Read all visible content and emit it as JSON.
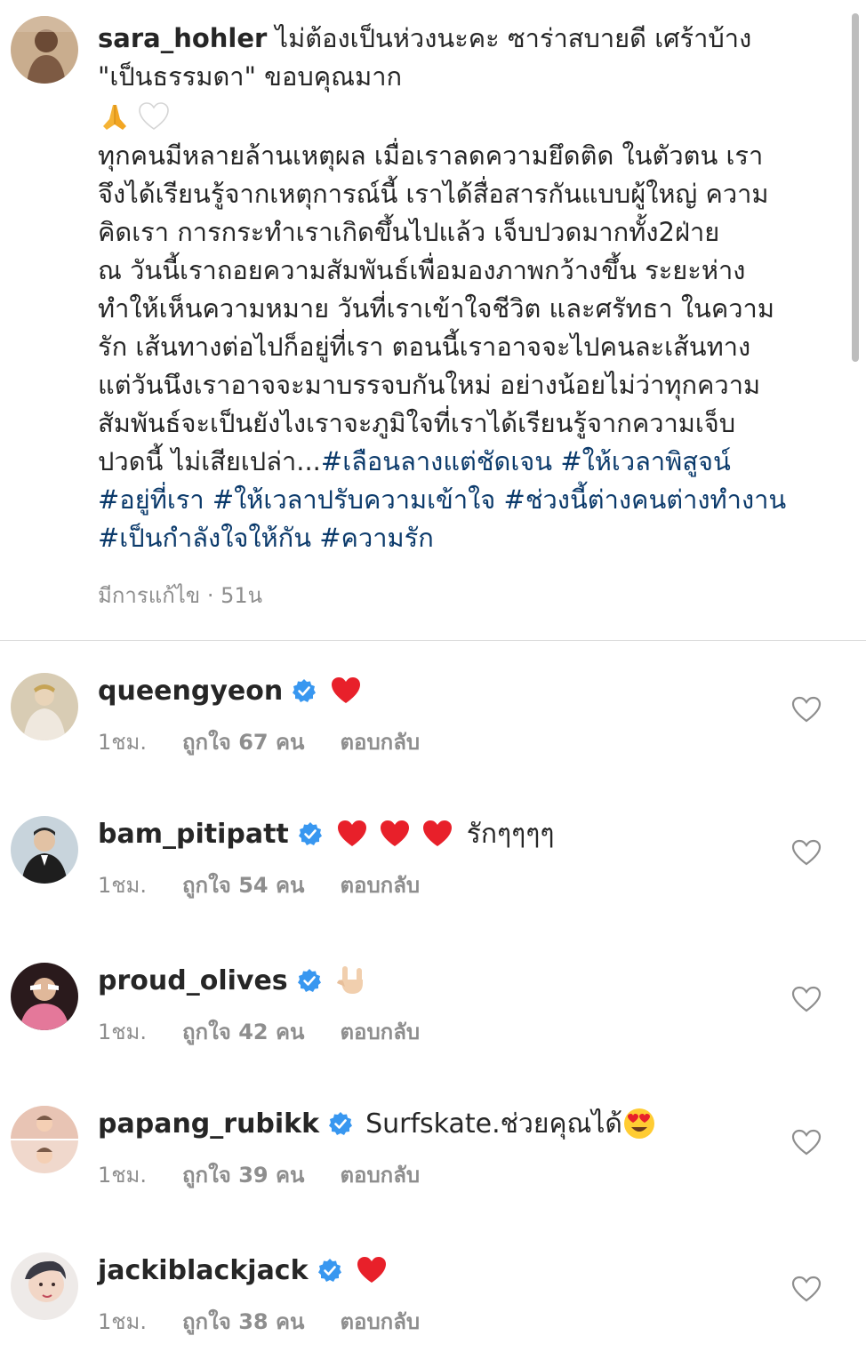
{
  "post": {
    "username": "sara_hohler",
    "caption_lines": [
      "ไม่ต้องเป็นห่วงนะคะ ซาร่าสบายดี เศร้าบ้าง",
      "\"เป็นธรรมดา\" ขอบคุณมาก"
    ],
    "caption_emojis": [
      "folded-hands-emoji",
      "white-heart-emoji"
    ],
    "body_lines": [
      "ทุกคนมีหลายล้านเหตุผล เมื่อเราลดความยึดติด ในตัวตน เรา",
      "จึงได้เรียนรู้จากเหตุการณ์นี้ เราได้สื่อสารกันแบบผู้ใหญ่ ความ",
      "คิดเรา การกระทำเราเกิดขึ้นไปแล้ว เจ็บปวดมากทั้ง2ฝ่าย",
      "ณ วันนี้เราถอยความสัมพันธ์เพื่อมองภาพกว้างขึ้น ระยะห่าง",
      "ทำให้เห็นความหมาย วันที่เราเข้าใจชีวิต และศรัทธา ในความ",
      "รัก เส้นทางต่อไปก็อยู่ที่เรา ตอนนี้เราอาจจะไปคนละเส้นทาง",
      "แต่วันนึงเราอาจจะมาบรรจบกันใหม่ อย่างน้อยไม่ว่าทุกความ",
      "สัมพันธ์จะเป็นยังไงเราจะภูมิใจที่เราได้เรียนรู้จากความเจ็บ"
    ],
    "body_last_text": "ปวดนี้ ไม่เสียเปล่า...",
    "hashtags_line1": [
      "#เลือนลางแต่ชัดเจน",
      "#ให้เวลาพิสูจน์"
    ],
    "hashtags_line2": [
      "#อยู่ที่เรา",
      "#ให้เวลาปรับความเข้าใจ",
      "#ช่วงนี้ต่างคนต่างทำงาน"
    ],
    "hashtags_line3": [
      "#เป็นกำลังใจให้กัน",
      "#ความรัก"
    ],
    "meta": "มีการแก้ไข · 51น"
  },
  "comments": [
    {
      "username": "queengyeon",
      "text": "",
      "emojis": [
        "red-heart-emoji"
      ],
      "time": "1ชม.",
      "likes": "ถูกใจ 67 คน",
      "reply": "ตอบกลับ"
    },
    {
      "username": "bam_pitipatt",
      "text": "รักๆๆๆๆ",
      "emojis": [
        "red-heart-emoji",
        "red-heart-emoji",
        "red-heart-emoji"
      ],
      "time": "1ชม.",
      "likes": "ถูกใจ 54 คน",
      "reply": "ตอบกลับ"
    },
    {
      "username": "proud_olives",
      "text": "",
      "emojis": [
        "love-you-gesture-emoji"
      ],
      "time": "1ชม.",
      "likes": "ถูกใจ 42 คน",
      "reply": "ตอบกลับ"
    },
    {
      "username": "papang_rubikk",
      "text": "Surfskate.ช่วยคุณได้",
      "emojis": [
        "heart-eyes-emoji"
      ],
      "time": "1ชม.",
      "likes": "ถูกใจ 39 คน",
      "reply": "ตอบกลับ"
    },
    {
      "username": "jackiblackjack",
      "text": "",
      "emojis": [
        "red-heart-emoji"
      ],
      "time": "1ชม.",
      "likes": "ถูกใจ 38 คน",
      "reply": "ตอบกลับ"
    }
  ],
  "colors": {
    "hashtag": "#0b3a6b",
    "verified": "#3897f0",
    "meta": "#8e8e8e",
    "divider": "#dbdbdb"
  }
}
